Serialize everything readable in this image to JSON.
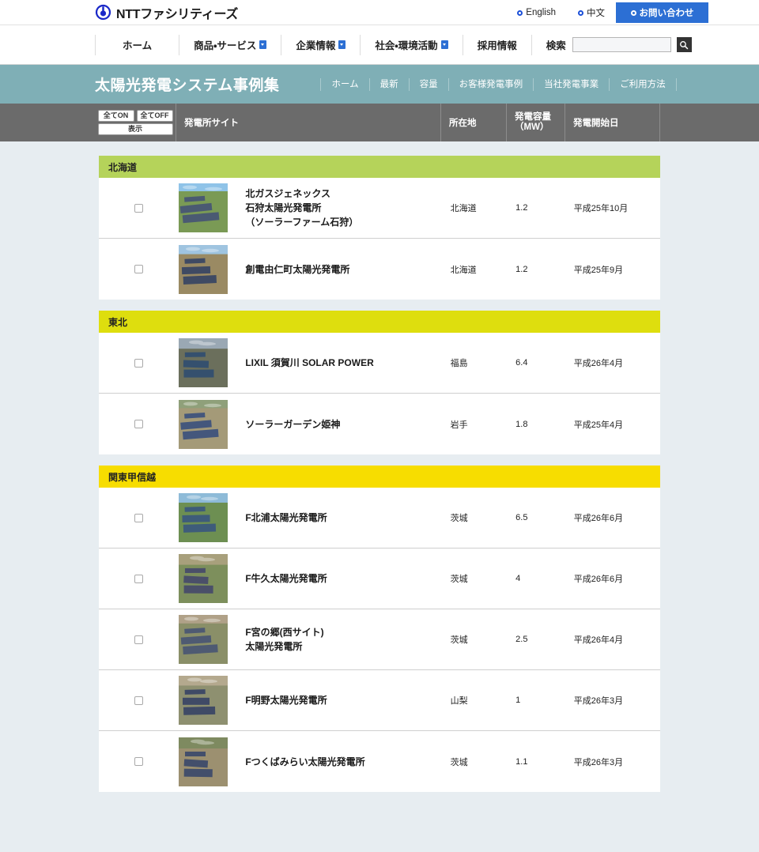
{
  "header": {
    "logo_text": "NTTファシリティーズ",
    "logo_icon": "ntt-circle-logo",
    "utility_links": [
      {
        "label": "English",
        "icon": "bullet-icon"
      },
      {
        "label": "中文",
        "icon": "bullet-icon"
      }
    ],
    "contact_button": "お問い合わせ"
  },
  "nav": {
    "items": [
      {
        "label": "ホーム",
        "has_dropdown": false
      },
      {
        "label": "商品・サービス",
        "has_dropdown": true
      },
      {
        "label": "企業情報",
        "has_dropdown": true
      },
      {
        "label": "社会・環境活動",
        "has_dropdown": true
      },
      {
        "label": "採用情報",
        "has_dropdown": false
      }
    ],
    "search_label": "検索",
    "search_value": "",
    "search_placeholder": "",
    "search_icon": "search-icon"
  },
  "banner": {
    "title": "太陽光発電システム事例集",
    "links": [
      "ホーム",
      "最新",
      "容量",
      "お客様発電事例",
      "当社発電事業",
      "ご利用方法"
    ]
  },
  "table": {
    "toggle_all_on": "全てON",
    "toggle_all_off": "全てOFF",
    "show_button": "表示",
    "columns": {
      "site": "発電所サイト",
      "location": "所在地",
      "capacity_line1": "発電容量",
      "capacity_line2": "（MW）",
      "start_date": "発電開始日"
    }
  },
  "colors": {
    "banner_teal": "#7fafb6",
    "table_header_gray": "#6b6b6b",
    "page_background": "#e7edf1",
    "contact_blue": "#2c6fd4",
    "region_hokkaido": "#b5d35a",
    "region_tohoku": "#dede0e",
    "region_kanto": "#f7dd00"
  },
  "regions": [
    {
      "name": "北海道",
      "color": "#b5d35a",
      "rows": [
        {
          "checked": false,
          "thumb": "solar-farm-aerial-blue-sky",
          "name": "北ガスジェネックス\n石狩太陽光発電所\n（ソーラーファーム石狩）",
          "location": "北海道",
          "capacity": "1.2",
          "start_date": "平成25年10月"
        },
        {
          "checked": false,
          "thumb": "solar-farm-aerial-field",
          "name": "創電由仁町太陽光発電所",
          "location": "北海道",
          "capacity": "1.2",
          "start_date": "平成25年9月"
        }
      ]
    },
    {
      "name": "東北",
      "color": "#dede0e",
      "rows": [
        {
          "checked": false,
          "thumb": "factory-rooftop-solar",
          "name": "LIXIL 須賀川 SOLAR POWER",
          "location": "福島",
          "capacity": "6.4",
          "start_date": "平成26年4月"
        },
        {
          "checked": false,
          "thumb": "riverside-solar-aerial",
          "name": "ソーラーガーデン姫神",
          "location": "岩手",
          "capacity": "1.8",
          "start_date": "平成25年4月"
        }
      ]
    },
    {
      "name": "関東甲信越",
      "color": "#f7dd00",
      "rows": [
        {
          "checked": false,
          "thumb": "large-solar-plant-aerial",
          "name": "F北浦太陽光発電所",
          "location": "茨城",
          "capacity": "6.5",
          "start_date": "平成26年6月"
        },
        {
          "checked": false,
          "thumb": "cross-layout-solar-aerial",
          "name": "F牛久太陽光発電所",
          "location": "茨城",
          "capacity": "4",
          "start_date": "平成26年6月"
        },
        {
          "checked": false,
          "thumb": "hillside-solar-aerial",
          "name": "F宮の郷(西サイト)\n太陽光発電所",
          "location": "茨城",
          "capacity": "2.5",
          "start_date": "平成26年4月"
        },
        {
          "checked": false,
          "thumb": "diamond-solar-field-aerial",
          "name": "F明野太陽光発電所",
          "location": "山梨",
          "capacity": "1",
          "start_date": "平成26年3月"
        },
        {
          "checked": false,
          "thumb": "wooded-solar-plot-aerial",
          "name": "Fつくばみらい太陽光発電所",
          "location": "茨城",
          "capacity": "1.1",
          "start_date": "平成26年3月"
        }
      ]
    }
  ]
}
